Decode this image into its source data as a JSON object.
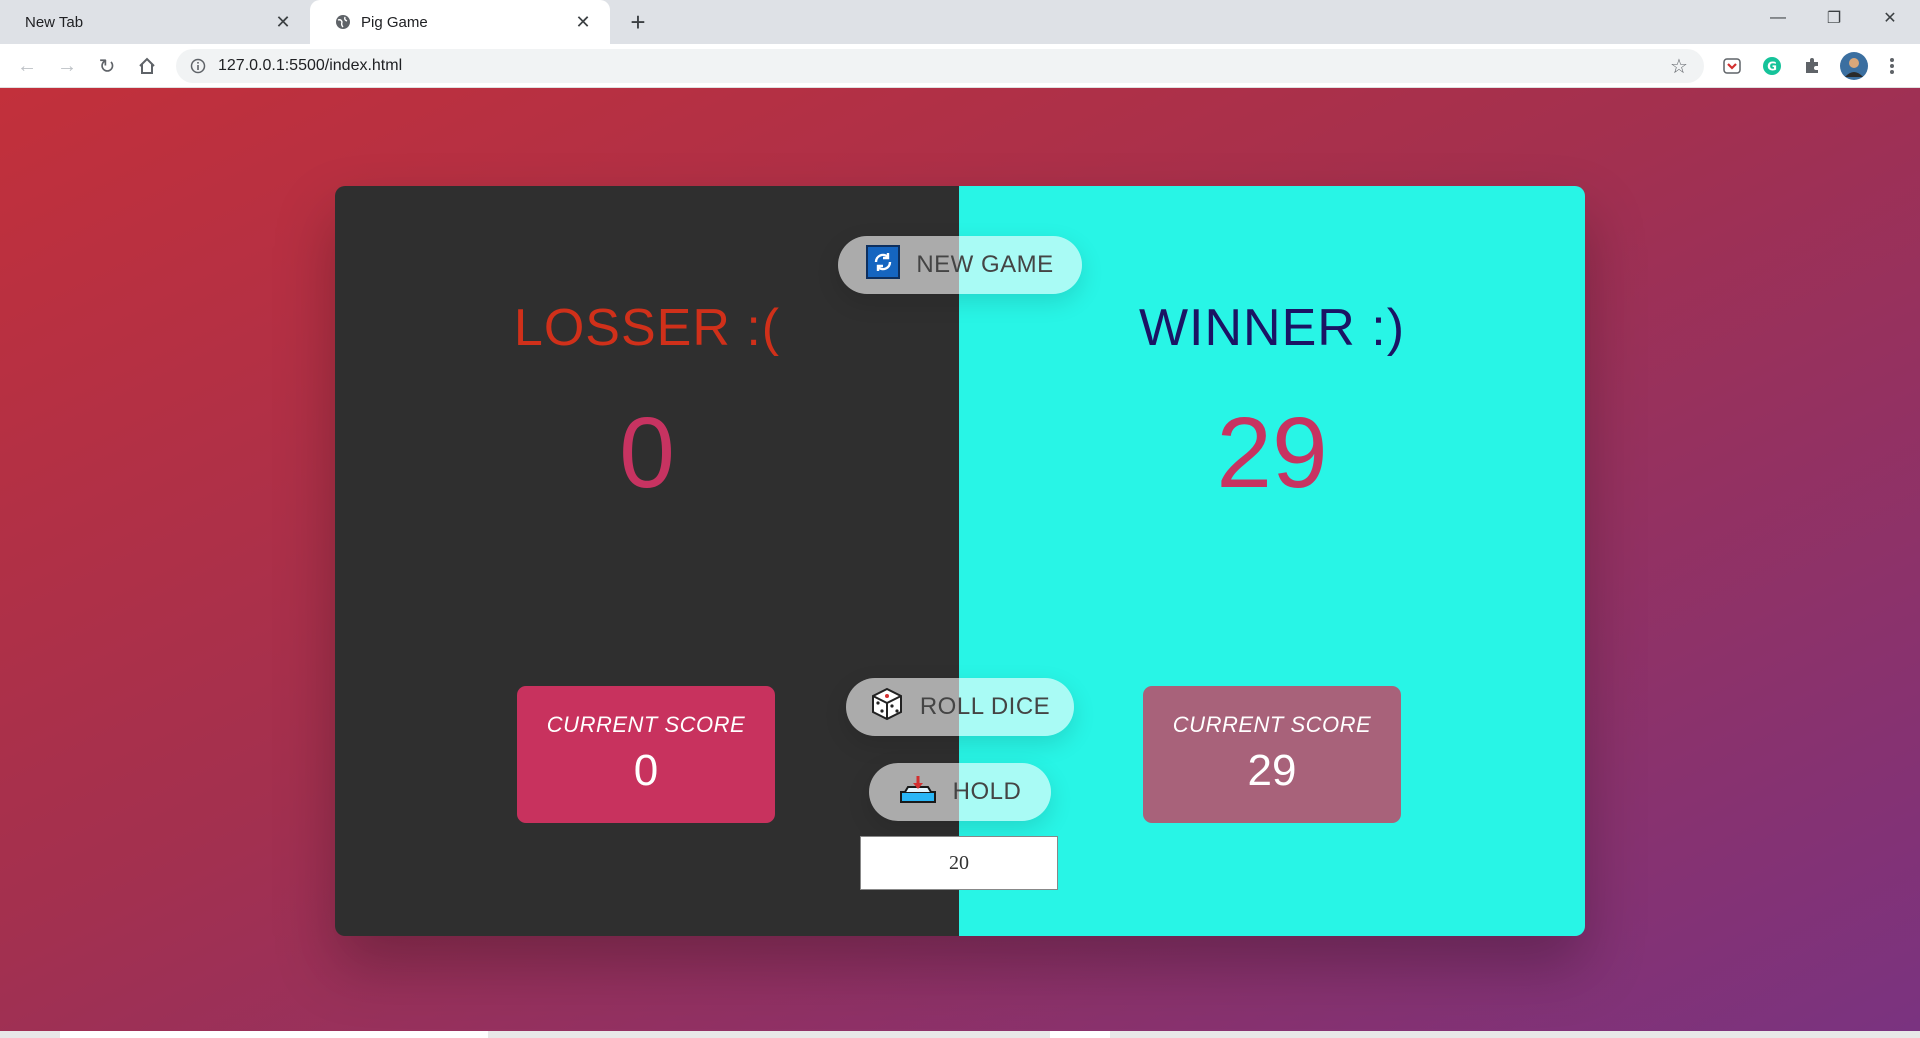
{
  "browser": {
    "tabs": [
      {
        "label": "New Tab"
      },
      {
        "label": "Pig Game"
      }
    ],
    "url": "127.0.0.1:5500/index.html"
  },
  "game": {
    "players": [
      {
        "name": "LOSSER :(",
        "score": "0",
        "current_label": "CURRENT SCORE",
        "current_value": "0"
      },
      {
        "name": "WINNER :)",
        "score": "29",
        "current_label": "CURRENT SCORE",
        "current_value": "29"
      }
    ],
    "buttons": {
      "new_game": "NEW GAME",
      "roll_dice": "ROLL DICE",
      "hold": "HOLD"
    },
    "target_score": "20"
  },
  "colors": {
    "player0_bg": "#2f2f2f",
    "player1_bg": "#28f5e6",
    "loser_name": "#d0301a",
    "winner_name": "#1b1464",
    "score": "#c73361"
  },
  "icons": {
    "new_game": "refresh-icon",
    "roll_dice": "dice-icon",
    "hold": "hold-tray-icon"
  }
}
